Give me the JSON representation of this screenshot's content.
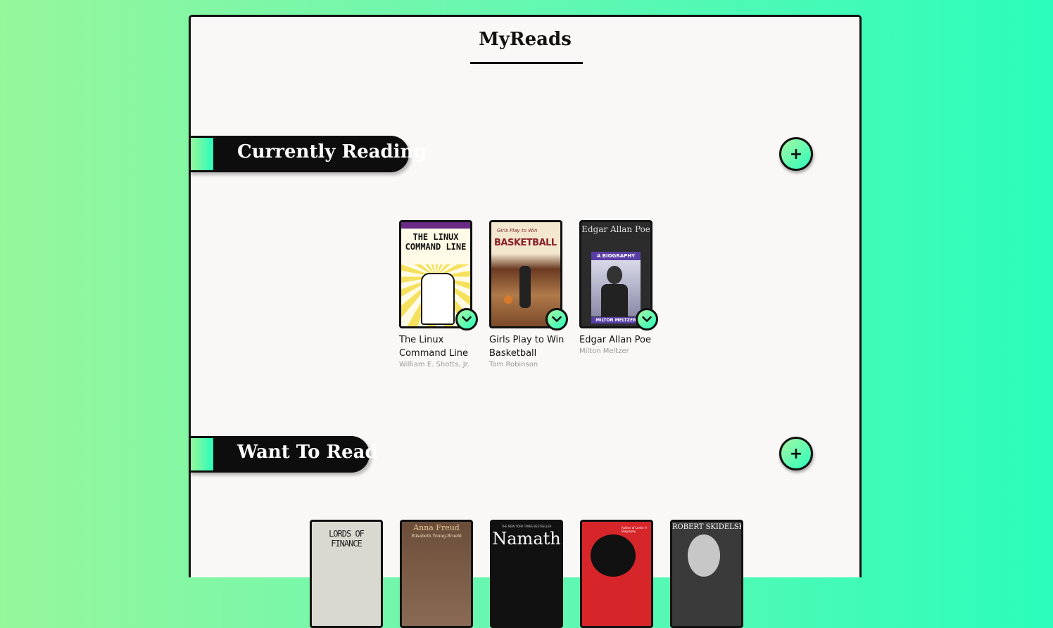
{
  "app": {
    "title": "MyReads"
  },
  "colors": {
    "accent_start": "#96f79b",
    "accent_end": "#2bfdbb",
    "panel": "#faf8f6",
    "ink": "#111111"
  },
  "shelves": [
    {
      "label": "Currently Reading",
      "add_label": "+",
      "books": [
        {
          "title": "The Linux Command Line",
          "author": "William E. Shotts, Jr.",
          "cover": {
            "line1": "THE LINUX",
            "line2": "COMMAND LINE"
          },
          "menu_icon": "chevron-down-icon"
        },
        {
          "title": "Girls Play to Win Basketball",
          "author": "Tom Robinson",
          "cover": {
            "line1": "Girls Play to Win",
            "line2": "BASKETBALL"
          },
          "menu_icon": "chevron-down-icon"
        },
        {
          "title": "Edgar Allan Poe",
          "author": "Milton Meltzer",
          "cover": {
            "line1": "Edgar Allan Poe",
            "line2": "A BIOGRAPHY",
            "line3": "MILTON MELTZER"
          },
          "menu_icon": "chevron-down-icon"
        }
      ]
    },
    {
      "label": "Want To Read",
      "add_label": "+",
      "books": [
        {
          "cover": {
            "line1": "LORDS OF FINANCE"
          }
        },
        {
          "cover": {
            "line1": "Anna Freud",
            "line2": "Elisabeth Young-Bruehl"
          }
        },
        {
          "cover": {
            "line0": "THE NEW YORK TIMES BESTSELLER",
            "line1": "Namath"
          }
        },
        {
          "cover": {
            "line1": "Author of Lords: A Biography"
          }
        },
        {
          "cover": {
            "line1": "ROBERT SKIDELSKY"
          }
        }
      ]
    }
  ]
}
